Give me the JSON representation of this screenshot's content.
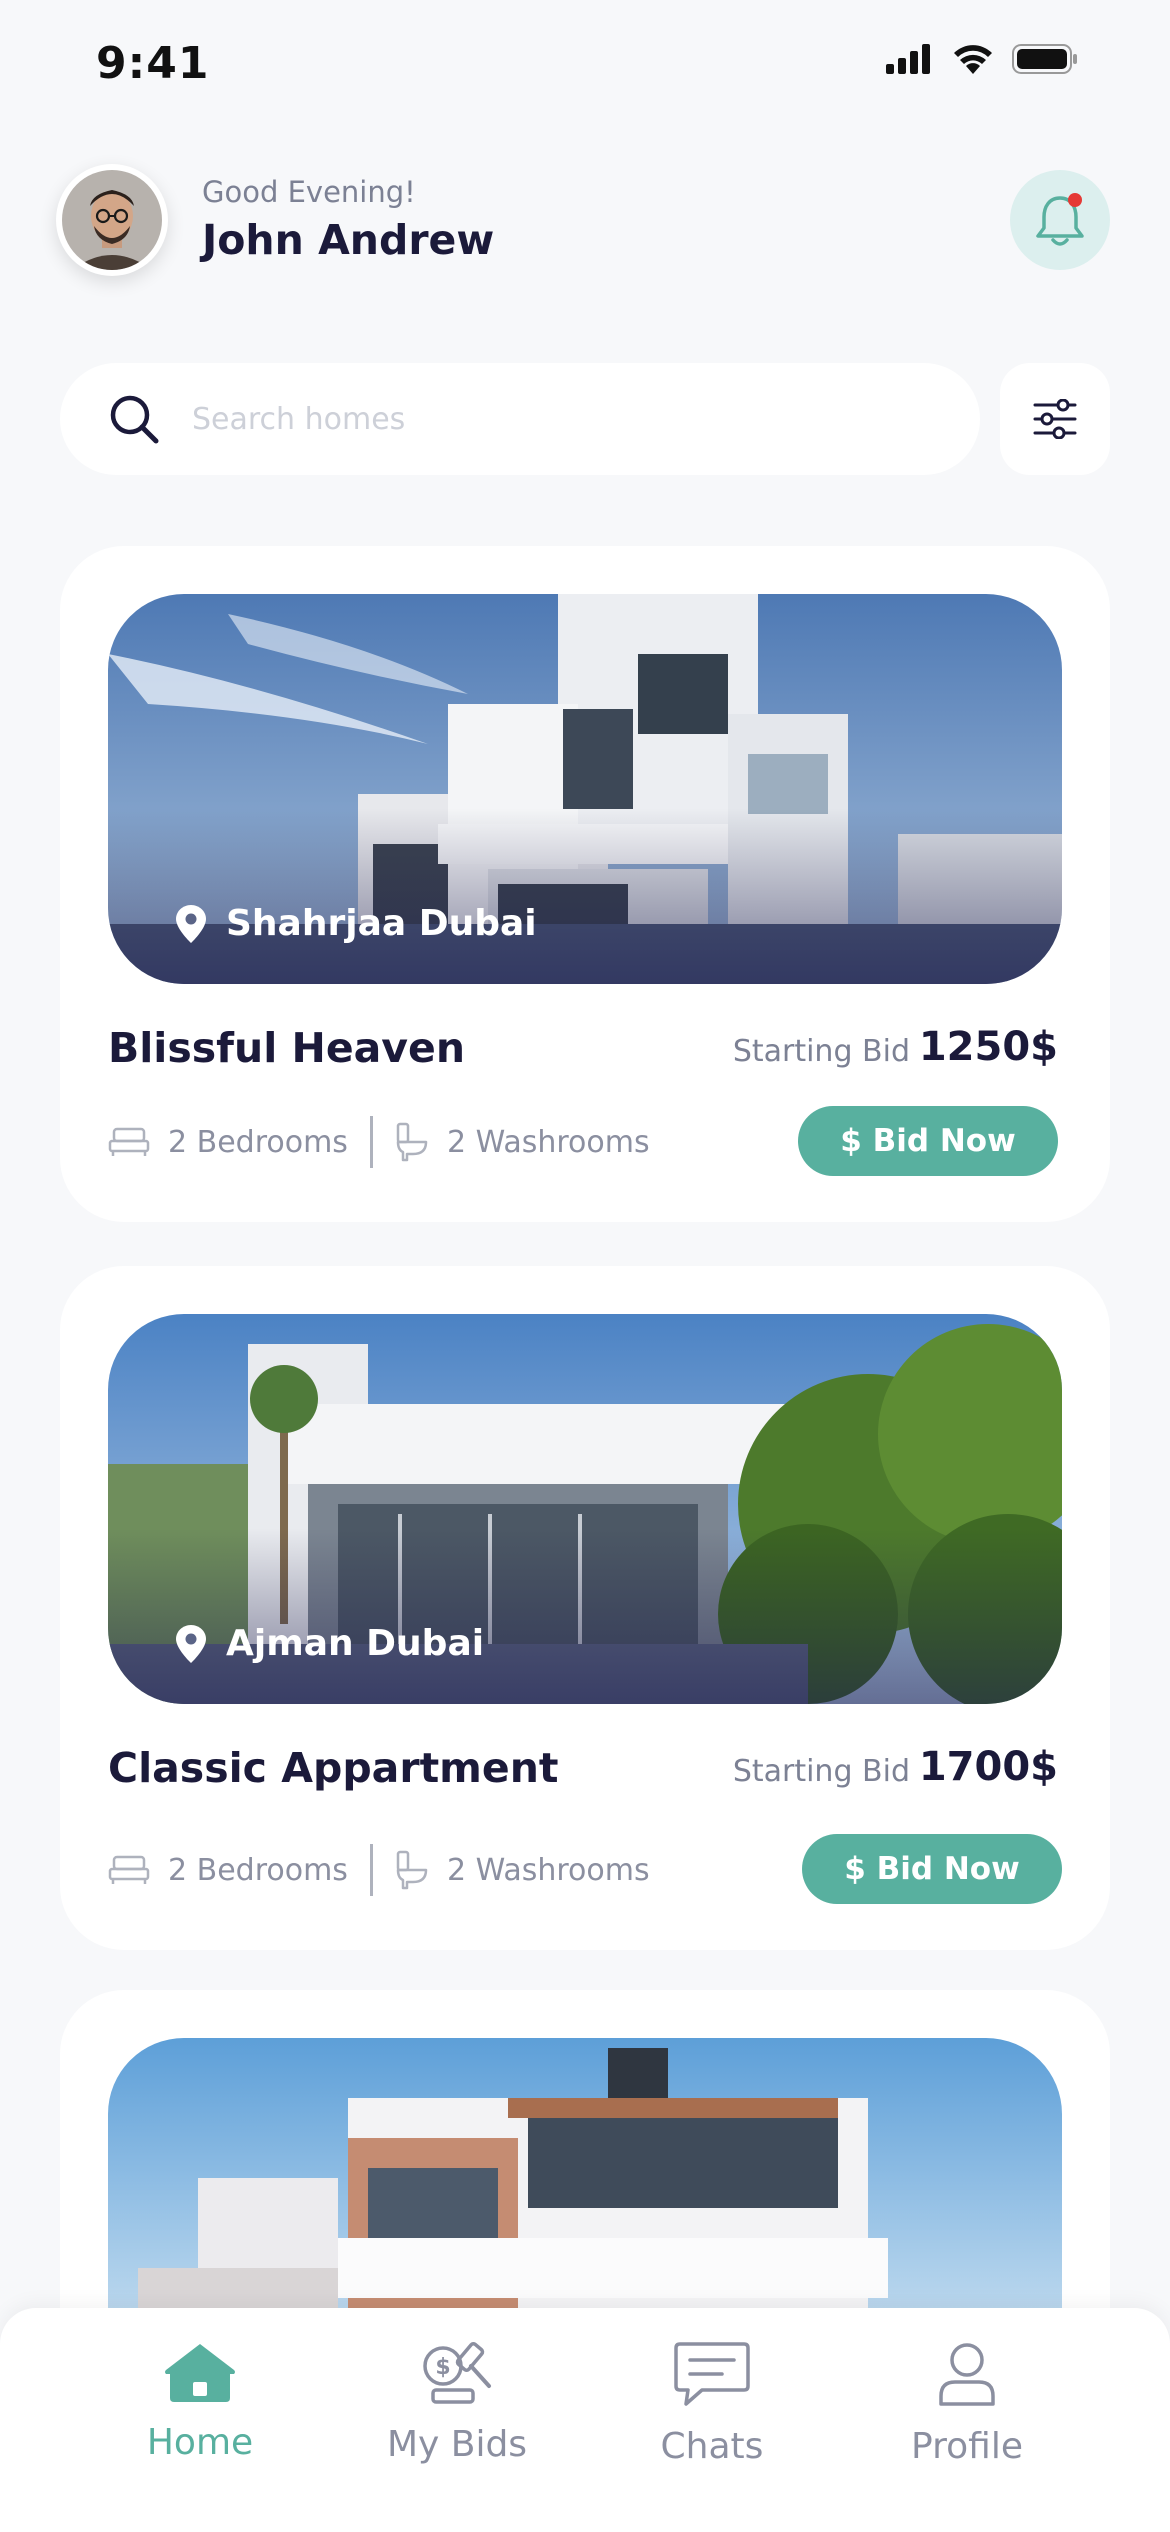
{
  "status_bar": {
    "time": "9:41"
  },
  "header": {
    "greeting": "Good Evening!",
    "user_name": "John Andrew"
  },
  "search": {
    "placeholder": "Search homes"
  },
  "listings": [
    {
      "location": "Shahrjaa Dubai",
      "title": "Blissful Heaven",
      "starting_bid_label": "Starting Bid",
      "starting_bid_value": "1250$",
      "bedrooms": "2 Bedrooms",
      "washrooms": "2 Washrooms",
      "bid_button": "$ Bid Now"
    },
    {
      "location": "Ajman Dubai",
      "title": "Classic Appartment",
      "starting_bid_label": "Starting Bid",
      "starting_bid_value": "1700$",
      "bedrooms": "2 Bedrooms",
      "washrooms": "2 Washrooms",
      "bid_button": "$ Bid Now"
    }
  ],
  "nav": {
    "items": [
      {
        "label": "Home",
        "icon": "home-icon",
        "active": true
      },
      {
        "label": "My Bids",
        "icon": "auction-icon",
        "active": false
      },
      {
        "label": "Chats",
        "icon": "chat-icon",
        "active": false
      },
      {
        "label": "Profile",
        "icon": "profile-icon",
        "active": false
      }
    ]
  },
  "colors": {
    "accent": "#58b09f",
    "text_dark": "#1b1a3a",
    "text_muted": "#7c8194",
    "bell_bg": "#dcefee",
    "notification_dot": "#e53935",
    "background": "#f7f8fa"
  }
}
